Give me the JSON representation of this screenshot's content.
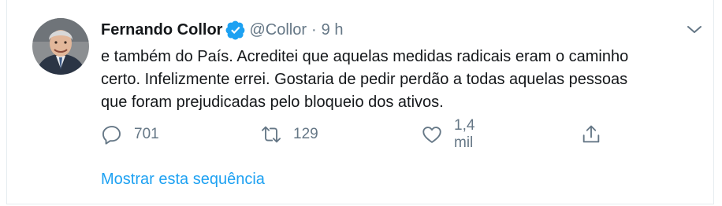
{
  "tweet": {
    "author_name": "Fernando Collor",
    "handle": "@Collor",
    "separator": "·",
    "time": "9 h",
    "text_lines": [
      "e também do País. Acreditei que aquelas medidas radicais eram o caminho",
      "certo. Infelizmente errei. Gostaria de pedir perdão a todas aquelas pessoas",
      "que foram prejudicadas pelo bloqueio dos ativos."
    ],
    "actions": {
      "reply_count": "701",
      "retweet_count": "129",
      "like_count": "1,4 mil"
    },
    "show_thread_label": "Mostrar esta sequência"
  },
  "icons": {
    "verified": "verified-badge-icon",
    "caret": "chevron-down-icon",
    "reply": "reply-icon",
    "retweet": "retweet-icon",
    "like": "heart-icon",
    "share": "share-icon"
  },
  "colors": {
    "accent": "#1da1f2",
    "secondary_text": "#657786",
    "primary_text": "#14171a",
    "border": "#e6ecf0"
  }
}
